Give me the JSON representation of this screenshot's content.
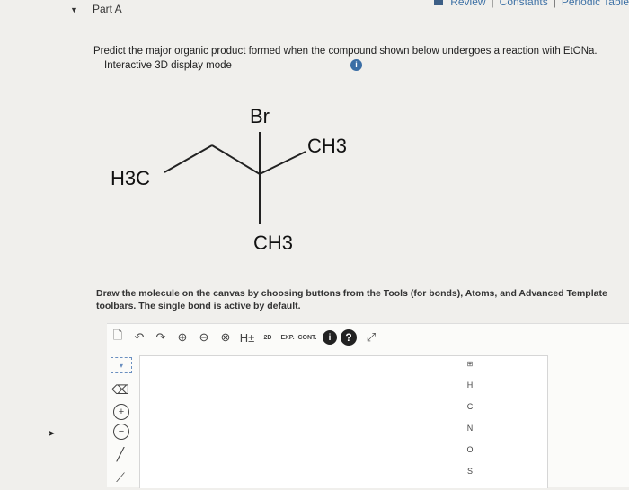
{
  "header": {
    "links": [
      "Review",
      "Constants",
      "Periodic Table"
    ],
    "part_label": "Part A",
    "toggle_icon": "triangle-down"
  },
  "question": {
    "text": "Predict the major organic product formed when the compound shown below undergoes a reaction with EtONa.",
    "mode_label": "Interactive 3D display mode",
    "info_icon": "i"
  },
  "molecule": {
    "br_label": "Br",
    "ch3_right": "CH3",
    "h3c_left": "H3C",
    "ch3_bottom": "CH3"
  },
  "instructions": {
    "text": "Draw the molecule on the canvas by choosing buttons from the Tools (for bonds), Atoms, and Advanced Template toolbars. The single bond is active by default."
  },
  "editor": {
    "toolbar": [
      {
        "name": "new-document-icon",
        "glyph": "🗋"
      },
      {
        "name": "undo-icon",
        "glyph": "↶"
      },
      {
        "name": "redo-icon",
        "glyph": "↷"
      },
      {
        "name": "zoom-in-icon",
        "glyph": "⊕"
      },
      {
        "name": "zoom-out-icon",
        "glyph": "⊖"
      },
      {
        "name": "zoom-reset-icon",
        "glyph": "⊗"
      },
      {
        "name": "explicit-hydrogens-icon",
        "glyph": "H±"
      },
      {
        "name": "cleanup-2d-icon",
        "glyph": "2D"
      },
      {
        "name": "expand-icon",
        "glyph": "EXP."
      },
      {
        "name": "contract-icon",
        "glyph": "CONT."
      }
    ],
    "help_label": "?",
    "atoms": [
      "H",
      "C",
      "N",
      "O",
      "S"
    ],
    "periodic_label": "⊞"
  }
}
